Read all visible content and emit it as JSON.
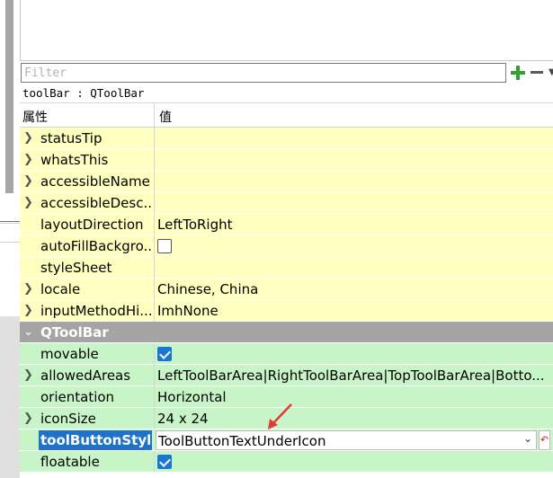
{
  "filter": {
    "placeholder": "Filter"
  },
  "object_label": "toolBar : QToolBar",
  "header": {
    "property": "属性",
    "value": "值"
  },
  "rows_qwidget": [
    {
      "name": "statusTip",
      "value": "",
      "expandable": true
    },
    {
      "name": "whatsThis",
      "value": "",
      "expandable": true
    },
    {
      "name": "accessibleName",
      "value": "",
      "expandable": true
    },
    {
      "name": "accessibleDesc...",
      "value": "",
      "expandable": true
    },
    {
      "name": "layoutDirection",
      "value": "LeftToRight",
      "expandable": false
    },
    {
      "name": "autoFillBackgro...",
      "value": "",
      "expandable": false,
      "checkbox": false
    },
    {
      "name": "styleSheet",
      "value": "",
      "expandable": false
    },
    {
      "name": "locale",
      "value": "Chinese, China",
      "expandable": true
    },
    {
      "name": "inputMethodHi...",
      "value": "ImhNone",
      "expandable": true
    }
  ],
  "section": {
    "name": "QToolBar"
  },
  "rows_qtoolbar": [
    {
      "name": "movable",
      "value": "",
      "expandable": false,
      "checkbox": true
    },
    {
      "name": "allowedAreas",
      "value": "LeftToolBarArea|RightToolBarArea|TopToolBarArea|Botto...",
      "expandable": true
    },
    {
      "name": "orientation",
      "value": "Horizontal",
      "expandable": false
    },
    {
      "name": "iconSize",
      "value": "24 x 24",
      "expandable": true
    },
    {
      "name": "toolButtonStyle",
      "value": "ToolButtonTextUnderIcon",
      "expandable": false,
      "editing": true
    },
    {
      "name": "floatable",
      "value": "",
      "expandable": false,
      "checkbox": true
    }
  ],
  "colors": {
    "yellow_row": "#ffffc0",
    "green_row": "#c8f5c8",
    "section_row": "#a4a4a4",
    "selection": "#1e73c8",
    "checkbox_checked": "#1976d2",
    "annotation_arrow": "#e53935"
  },
  "icons": {
    "add": "plus-icon",
    "remove": "minus-icon",
    "expand": "chevron-right-icon",
    "collapse": "chevron-down-icon",
    "reset": "reset-icon"
  }
}
